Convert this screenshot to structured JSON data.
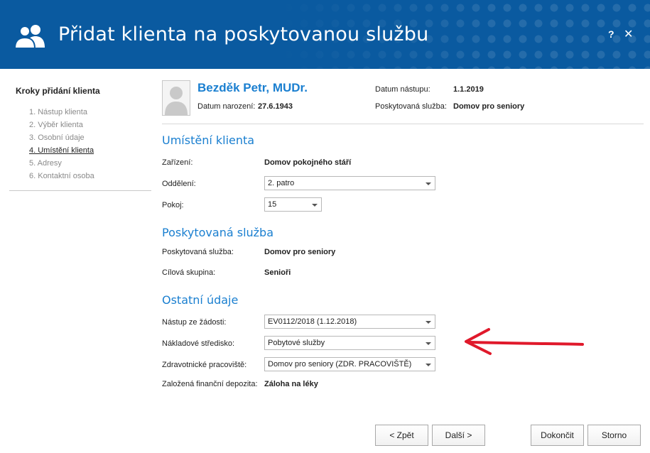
{
  "window": {
    "title": "Přidat klienta na poskytovanou službu",
    "help_label": "?",
    "close_label": "✕",
    "icon": "users-icon",
    "header_color": "#0a5aa0"
  },
  "sidebar": {
    "title": "Kroky přidání klienta",
    "steps": [
      {
        "label": "1. Nástup klienta"
      },
      {
        "label": "2. Výběr klienta"
      },
      {
        "label": "3. Osobní údaje"
      },
      {
        "label": "4. Umístění klienta"
      },
      {
        "label": "5. Adresy"
      },
      {
        "label": "6. Kontaktní osoba"
      }
    ],
    "active_step": 4
  },
  "client": {
    "name": "Bezděk Petr, MUDr.",
    "birth_label": "Datum narození:",
    "birth_value": "27.6.1943",
    "start_label": "Datum nástupu:",
    "start_value": "1.1.2019",
    "service_label": "Poskytovaná služba:",
    "service_value": "Domov pro seniory",
    "avatar_icon": "person-placeholder-icon"
  },
  "placement": {
    "heading": "Umístění klienta",
    "facility_label": "Zařízení:",
    "facility_value": "Domov pokojného stáří",
    "department_label": "Oddělení:",
    "department_value": "2. patro",
    "room_label": "Pokoj:",
    "room_value": "15"
  },
  "service": {
    "heading": "Poskytovaná služba",
    "service_label": "Poskytovaná služba:",
    "service_value": "Domov pro seniory",
    "target_label": "Cílová skupina:",
    "target_value": "Senioři"
  },
  "other": {
    "heading": "Ostatní údaje",
    "request_label": "Nástup ze žádosti:",
    "request_value": "EV0112/2018 (1.12.2018)",
    "cost_center_label": "Nákladové středisko:",
    "cost_center_value": "Pobytové služby",
    "workplace_label": "Zdravotnické pracoviště:",
    "workplace_value": "Domov pro seniory (ZDR. PRACOVIŠTĚ)",
    "deposit_label": "Založená finanční depozita:",
    "deposit_value": "Záloha na léky"
  },
  "buttons": {
    "back": "< Zpět",
    "next": "Další >",
    "finish": "Dokončit",
    "cancel": "Storno"
  },
  "annotation": {
    "arrow_color": "#e0192b"
  }
}
